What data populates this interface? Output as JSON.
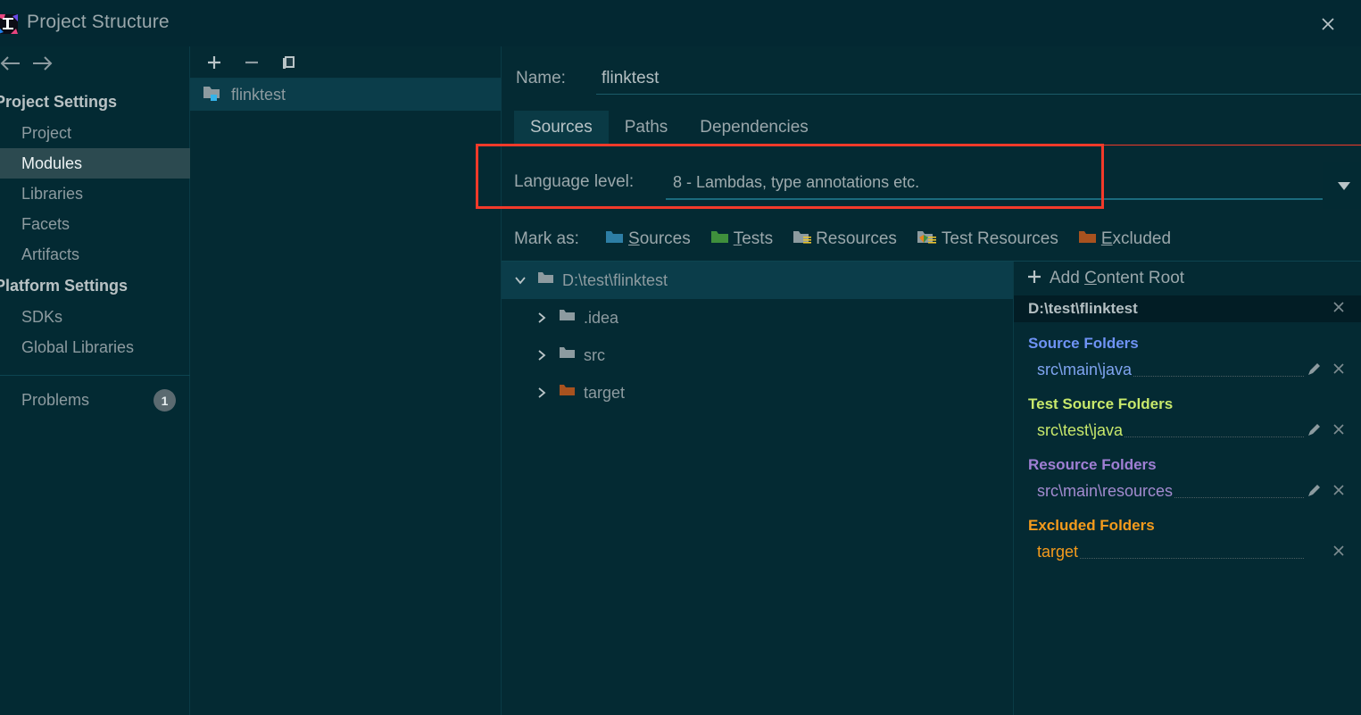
{
  "window": {
    "title": "Project Structure",
    "logo_icon": "intellij-idea-logo",
    "close_icon": "close-icon"
  },
  "nav": {
    "back_icon": "arrow-left-icon",
    "forward_icon": "arrow-right-icon"
  },
  "sidebar": {
    "groups": [
      {
        "label": "Project Settings",
        "items": [
          {
            "label": "Project",
            "selected": false
          },
          {
            "label": "Modules",
            "selected": true
          },
          {
            "label": "Libraries",
            "selected": false
          },
          {
            "label": "Facets",
            "selected": false
          },
          {
            "label": "Artifacts",
            "selected": false
          }
        ]
      },
      {
        "label": "Platform Settings",
        "items": [
          {
            "label": "SDKs",
            "selected": false
          },
          {
            "label": "Global Libraries",
            "selected": false
          }
        ]
      }
    ],
    "problems": {
      "label": "Problems",
      "count": "1"
    }
  },
  "module_list": {
    "toolbar": [
      {
        "name": "add-module-button",
        "icon": "plus-icon"
      },
      {
        "name": "remove-module-button",
        "icon": "minus-icon"
      },
      {
        "name": "copy-module-button",
        "icon": "copy-icon"
      }
    ],
    "modules": [
      {
        "label": "flinktest",
        "icon": "module-folder-icon",
        "selected": true
      }
    ]
  },
  "detail": {
    "name_label": "Name:",
    "name_value": "flinktest",
    "tabs": [
      {
        "label": "Sources",
        "active": true
      },
      {
        "label": "Paths",
        "active": false
      },
      {
        "label": "Dependencies",
        "active": false
      }
    ],
    "language_level": {
      "label": "Language level:",
      "value": "8 - Lambdas, type annotations etc.",
      "dropdown_icon": "chevron-down-icon"
    },
    "mark_as": {
      "label": "Mark as:",
      "options": [
        {
          "label": "Sources",
          "mnemonic": "S",
          "rest": "ources",
          "icon": "folder-sources-icon",
          "color": "#2d7ea5"
        },
        {
          "label": "Tests",
          "mnemonic": "T",
          "rest": "ests",
          "icon": "folder-tests-icon",
          "color": "#3f8f3c"
        },
        {
          "label": "Resources",
          "mnemonic": "",
          "rest": "Resources",
          "icon": "folder-resources-icon",
          "color": "#8d9ba0"
        },
        {
          "label": "Test Resources",
          "mnemonic": "",
          "rest": "Test Resources",
          "icon": "folder-test-resources-icon",
          "color": "#8d9ba0"
        },
        {
          "label": "Excluded",
          "mnemonic": "E",
          "rest": "xcluded",
          "icon": "folder-excluded-icon",
          "color": "#a8521f"
        }
      ]
    }
  },
  "tree": {
    "rows": [
      {
        "label": "D:\\test\\flinktest",
        "expanded": true,
        "depth": 0,
        "icon": "folder-icon",
        "selected": true,
        "chevron": "chevron-down-icon"
      },
      {
        "label": ".idea",
        "expanded": false,
        "depth": 1,
        "icon": "folder-icon",
        "selected": false,
        "chevron": "chevron-right-icon"
      },
      {
        "label": "src",
        "expanded": false,
        "depth": 1,
        "icon": "folder-icon",
        "selected": false,
        "chevron": "chevron-right-icon"
      },
      {
        "label": "target",
        "expanded": false,
        "depth": 1,
        "icon": "folder-excluded-icon",
        "selected": false,
        "chevron": "chevron-right-icon"
      }
    ]
  },
  "content_roots": {
    "add_label_prefix": "Add ",
    "add_label_mnemonic": "C",
    "add_label_rest": "ontent Root",
    "add_icon": "plus-icon",
    "root_path": "D:\\test\\flinktest",
    "root_remove_icon": "close-icon",
    "sections": [
      {
        "title": "Source Folders",
        "color": "#6f93f5",
        "path_color": "#7fa4f0",
        "rows": [
          {
            "path": "src\\main\\java",
            "edit_icon": "pencil-icon",
            "remove_icon": "close-icon",
            "has_edit": true
          }
        ]
      },
      {
        "title": "Test Source Folders",
        "color": "#c8e86b",
        "path_color": "#c8e86b",
        "rows": [
          {
            "path": "src\\test\\java",
            "edit_icon": "pencil-icon",
            "remove_icon": "close-icon",
            "has_edit": true
          }
        ]
      },
      {
        "title": "Resource Folders",
        "color": "#a07fd4",
        "path_color": "#a38bd0",
        "rows": [
          {
            "path": "src\\main\\resources",
            "edit_icon": "pencil-icon",
            "remove_icon": "close-icon",
            "has_edit": true
          }
        ]
      },
      {
        "title": "Excluded Folders",
        "color": "#f59b1c",
        "path_color": "#f59b1c",
        "rows": [
          {
            "path": "target",
            "edit_icon": "",
            "remove_icon": "close-icon",
            "has_edit": false
          }
        ]
      }
    ]
  },
  "annotation": {
    "highlight_color": "#f33a2a",
    "name": "language-level-highlight"
  }
}
